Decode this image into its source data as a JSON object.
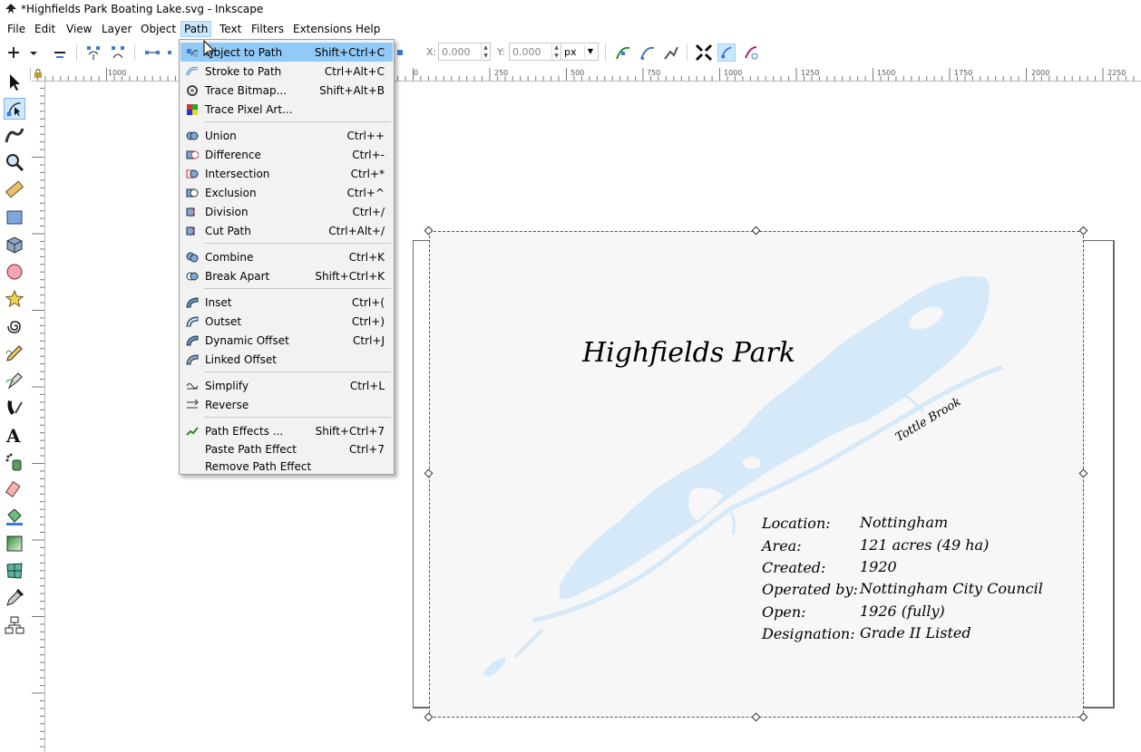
{
  "window": {
    "title": "*Highfields Park Boating Lake.svg - Inkscape",
    "app_icon": "inkscape-icon"
  },
  "menubar": [
    "File",
    "Edit",
    "View",
    "Layer",
    "Object",
    "Path",
    "Text",
    "Filters",
    "Extensions",
    "Help"
  ],
  "menubar_active": "Path",
  "toolbar": {
    "x_label": "X:",
    "x_value": "0.000",
    "y_label": "Y:",
    "y_value": "0.000",
    "unit": "px"
  },
  "rulers": {
    "horizontal_labels": [
      "1000",
      "0",
      "250",
      "500",
      "750",
      "1000",
      "1250",
      "1500",
      "1750",
      "2000",
      "2250"
    ]
  },
  "path_menu": {
    "items": [
      {
        "label": "Object to Path",
        "shortcut": "Shift+Ctrl+C",
        "icon": "object-to-path-icon",
        "highlighted": true
      },
      {
        "label": "Stroke to Path",
        "shortcut": "Ctrl+Alt+C",
        "icon": "stroke-to-path-icon"
      },
      {
        "label": "Trace Bitmap...",
        "shortcut": "Shift+Alt+B",
        "icon": "trace-bitmap-icon"
      },
      {
        "label": "Trace Pixel Art...",
        "shortcut": "",
        "icon": "trace-pixel-art-icon"
      },
      {
        "separator": true
      },
      {
        "label": "Union",
        "shortcut": "Ctrl++",
        "icon": "union-icon"
      },
      {
        "label": "Difference",
        "shortcut": "Ctrl+-",
        "icon": "difference-icon"
      },
      {
        "label": "Intersection",
        "shortcut": "Ctrl+*",
        "icon": "intersection-icon"
      },
      {
        "label": "Exclusion",
        "shortcut": "Ctrl+^",
        "icon": "exclusion-icon"
      },
      {
        "label": "Division",
        "shortcut": "Ctrl+/",
        "icon": "division-icon"
      },
      {
        "label": "Cut Path",
        "shortcut": "Ctrl+Alt+/",
        "icon": "cut-path-icon"
      },
      {
        "separator": true
      },
      {
        "label": "Combine",
        "shortcut": "Ctrl+K",
        "icon": "combine-icon"
      },
      {
        "label": "Break Apart",
        "shortcut": "Shift+Ctrl+K",
        "icon": "break-apart-icon"
      },
      {
        "separator": true
      },
      {
        "label": "Inset",
        "shortcut": "Ctrl+(",
        "icon": "inset-icon"
      },
      {
        "label": "Outset",
        "shortcut": "Ctrl+)",
        "icon": "outset-icon"
      },
      {
        "label": "Dynamic Offset",
        "shortcut": "Ctrl+J",
        "icon": "dynamic-offset-icon"
      },
      {
        "label": "Linked Offset",
        "shortcut": "",
        "icon": "linked-offset-icon"
      },
      {
        "separator": true
      },
      {
        "label": "Simplify",
        "shortcut": "Ctrl+L",
        "icon": "simplify-icon"
      },
      {
        "label": "Reverse",
        "shortcut": "",
        "icon": "reverse-icon"
      },
      {
        "separator": true
      },
      {
        "label": "Path Effects ...",
        "shortcut": "Shift+Ctrl+7",
        "icon": "path-effects-icon"
      },
      {
        "label": "Paste Path Effect",
        "shortcut": "Ctrl+7",
        "icon": ""
      },
      {
        "label": "Remove Path Effect",
        "shortcut": "",
        "icon": ""
      }
    ]
  },
  "drawing": {
    "title": "Highfields Park",
    "brook_label": "Tottle Brook",
    "info": [
      {
        "key": "Location:",
        "value": "Nottingham"
      },
      {
        "key": "Area:",
        "value": "121 acres (49 ha)"
      },
      {
        "key": "Created:",
        "value": "1920"
      },
      {
        "key": "Operated by:",
        "value": "Nottingham City Council"
      },
      {
        "key": "Open:",
        "value": "1926 (fully)"
      },
      {
        "key": "Designation:",
        "value": "Grade II Listed"
      }
    ],
    "lake_color": "#d6e9f8"
  },
  "colors": {
    "menu_highlight": "#91c9f7",
    "menubar_active": "#cce8ff"
  }
}
